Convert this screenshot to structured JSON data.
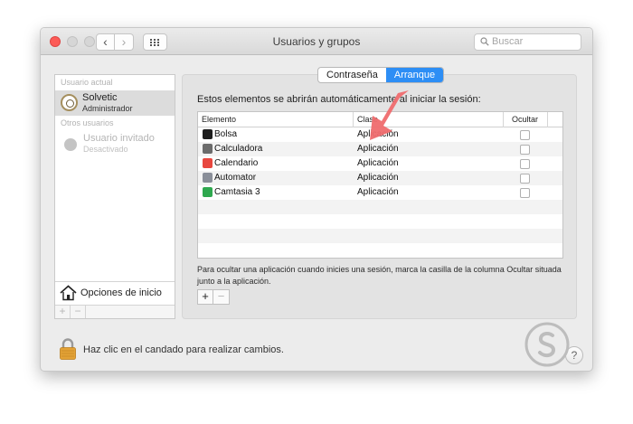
{
  "window": {
    "title": "Usuarios y grupos",
    "search_placeholder": "Buscar",
    "icons": [
      "back-icon",
      "forward-icon",
      "grid-icon",
      "search-icon"
    ]
  },
  "sidebar": {
    "current_user_section": "Usuario actual",
    "current_user": {
      "name": "Solvetic",
      "role": "Administrador"
    },
    "other_users_section": "Otros usuarios",
    "guest_user": {
      "name": "Usuario invitado",
      "status": "Desactivado"
    },
    "login_options_label": "Opciones de inicio",
    "add_label": "+",
    "remove_label": "−"
  },
  "tabs": {
    "password_label": "Contraseña",
    "startup_label": "Arranque",
    "selected": "Arranque"
  },
  "startup": {
    "info_text": "Estos elementos se abrirán automáticamente al iniciar la sesión:",
    "columns": {
      "item": "Elemento",
      "type": "Clase",
      "hide": "Ocultar"
    },
    "items": [
      {
        "name": "Bolsa",
        "type": "Aplicación",
        "hidden": false,
        "icon_color": "#1d1d1d"
      },
      {
        "name": "Calculadora",
        "type": "Aplicación",
        "hidden": false,
        "icon_color": "#6b6b6b"
      },
      {
        "name": "Calendario",
        "type": "Aplicación",
        "hidden": false,
        "icon_color": "#e8473f"
      },
      {
        "name": "Automator",
        "type": "Aplicación",
        "hidden": false,
        "icon_color": "#8a8f99"
      },
      {
        "name": "Camtasia 3",
        "type": "Aplicación",
        "hidden": false,
        "icon_color": "#2fa84f"
      }
    ],
    "hint": "Para ocultar una aplicación cuando inicies una sesión, marca la casilla de la columna Ocultar situada junto a la aplicación.",
    "add_label": "+",
    "remove_label": "−"
  },
  "footer": {
    "lock_text": "Haz clic en el candado para realizar cambios.",
    "help_label": "?"
  },
  "colors": {
    "selected_tab": "#2d8ef5",
    "annotation_arrow": "#ef6b6e"
  }
}
